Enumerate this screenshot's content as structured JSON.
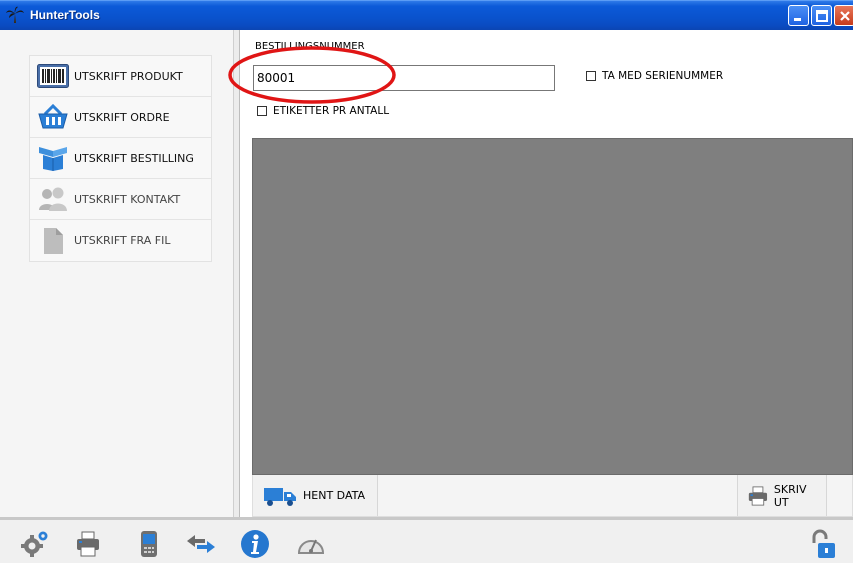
{
  "window": {
    "title": "HunterTools",
    "controls": [
      "minimize",
      "maximize",
      "close"
    ]
  },
  "sidebar": {
    "items": [
      {
        "label": "UTSKRIFT PRODUKT",
        "icon": "barcode-icon",
        "enabled": true
      },
      {
        "label": "UTSKRIFT ORDRE",
        "icon": "basket-icon",
        "enabled": true
      },
      {
        "label": "UTSKRIFT BESTILLING",
        "icon": "box-icon",
        "enabled": true
      },
      {
        "label": "UTSKRIFT KONTAKT",
        "icon": "contacts-icon",
        "enabled": false
      },
      {
        "label": "UTSKRIFT FRA FIL",
        "icon": "file-icon",
        "enabled": false
      }
    ]
  },
  "main": {
    "order_label": "BESTILLINGSNUMMER",
    "order_value": "80001",
    "include_serial_label": "TA MED SERIENUMMER",
    "include_serial_checked": false,
    "labels_per_qty_label": "ETIKETTER PR ANTALL",
    "labels_per_qty_checked": false,
    "fetch_button": "HENT DATA",
    "print_button": "SKRIV UT"
  },
  "toolbar": {
    "icons": [
      "settings-icon",
      "printer-icon",
      "handheld-device-icon",
      "sync-arrows-icon",
      "info-icon",
      "speedometer-icon",
      "unlock-icon"
    ]
  },
  "colors": {
    "titlebar": "#0a52cc",
    "preview_bg": "#7f7f7f",
    "highlight": "#e01515",
    "icon_blue": "#2b7fd6"
  }
}
